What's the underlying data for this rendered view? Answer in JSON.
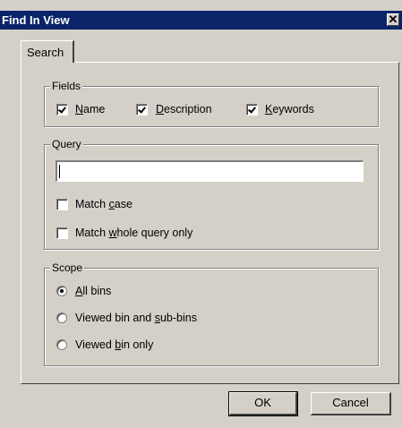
{
  "window": {
    "title": "Find In View",
    "close_symbol": "✕"
  },
  "tabs": [
    {
      "label": "Search",
      "selected": true
    }
  ],
  "fields": {
    "label": "Fields",
    "options": [
      {
        "prefix": "",
        "underline": "N",
        "suffix": "ame",
        "checked": true
      },
      {
        "prefix": "",
        "underline": "D",
        "suffix": "escription",
        "checked": true
      },
      {
        "prefix": "",
        "underline": "K",
        "suffix": "eywords",
        "checked": true
      }
    ]
  },
  "query": {
    "label": "Query",
    "value": "",
    "match_case": {
      "prefix": "Match ",
      "underline": "c",
      "suffix": "ase",
      "checked": false
    },
    "match_whole": {
      "prefix": "Match ",
      "underline": "w",
      "suffix": "hole query only",
      "checked": false
    }
  },
  "scope": {
    "label": "Scope",
    "options": [
      {
        "prefix": "",
        "underline": "A",
        "suffix": "ll bins",
        "selected": true
      },
      {
        "prefix": "Viewed bin and ",
        "underline": "s",
        "suffix": "ub-bins",
        "selected": false
      },
      {
        "prefix": "Viewed ",
        "underline": "b",
        "suffix": "in only",
        "selected": false
      }
    ]
  },
  "buttons": {
    "ok": "OK",
    "cancel": "Cancel"
  }
}
